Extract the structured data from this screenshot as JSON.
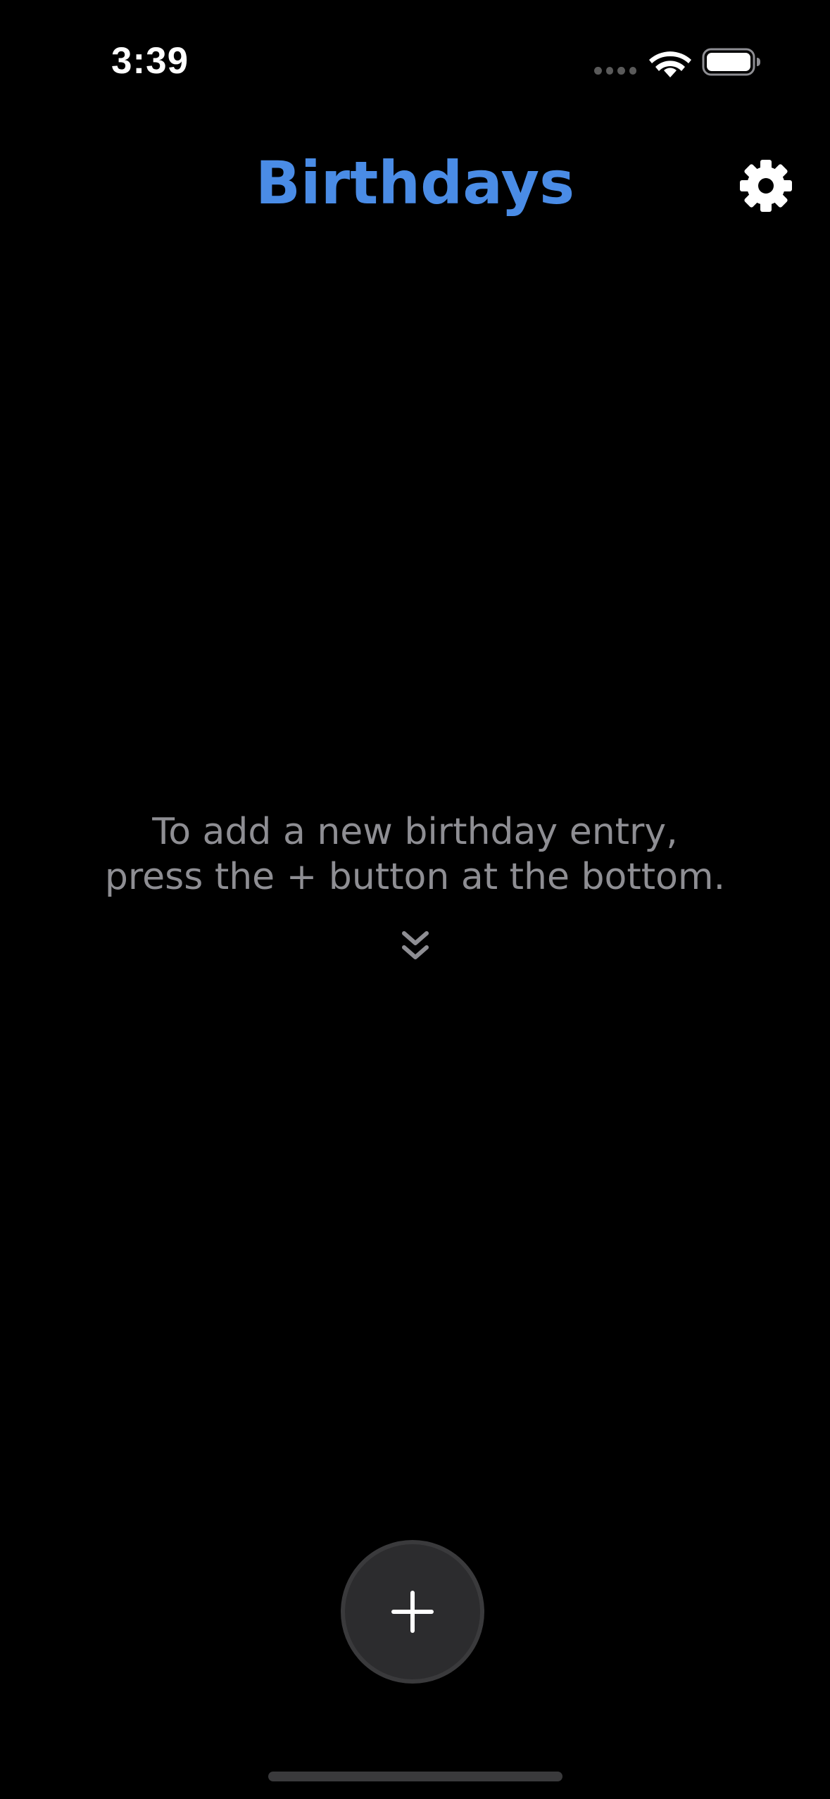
{
  "status_bar": {
    "time": "3:39",
    "icons": [
      "signal-dots-icon",
      "wifi-icon",
      "battery-icon"
    ]
  },
  "header": {
    "title": "Birthdays",
    "settings_icon": "gear-icon"
  },
  "empty_state": {
    "line1": "To add a new birthday entry,",
    "line2": "press the + button at the bottom.",
    "hint_icon": "chevron-double-down-icon"
  },
  "add_button": {
    "icon": "plus-icon"
  },
  "colors": {
    "background": "#000000",
    "accent": "#4a8ce6",
    "secondary_text": "#8e8e93",
    "button_fill": "#2c2c2e",
    "button_border": "#3a3a3c"
  }
}
